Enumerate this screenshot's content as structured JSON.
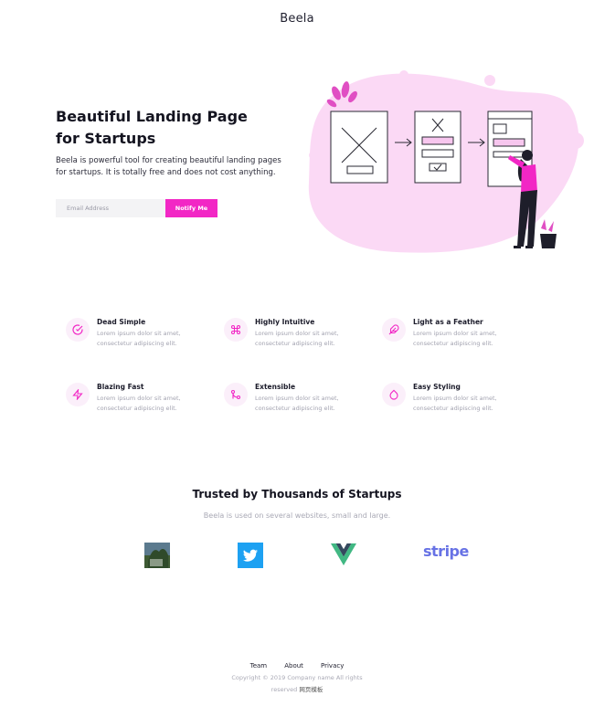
{
  "brand": "Beela",
  "hero": {
    "title": "Beautiful Landing Page for Startups",
    "subtitle": "Beela is powerful tool for creating beautiful landing pages for startups. It is totally free and does not cost anything.",
    "email_placeholder": "Email Address",
    "notify_label": "Notify Me"
  },
  "features": [
    {
      "title": "Dead Simple",
      "desc": "Lorem ipsum dolor sit amet, consectetur adipiscing elit.",
      "icon": "check-circle-icon"
    },
    {
      "title": "Highly Intuitive",
      "desc": "Lorem ipsum dolor sit amet, consectetur adipiscing elit.",
      "icon": "command-icon"
    },
    {
      "title": "Light as a Feather",
      "desc": "Lorem ipsum dolor sit amet, consectetur adipiscing elit.",
      "icon": "feather-icon"
    },
    {
      "title": "Blazing Fast",
      "desc": "Lorem ipsum dolor sit amet, consectetur adipiscing elit.",
      "icon": "zap-icon"
    },
    {
      "title": "Extensible",
      "desc": "Lorem ipsum dolor sit amet, consectetur adipiscing elit.",
      "icon": "git-merge-icon"
    },
    {
      "title": "Easy Styling",
      "desc": "Lorem ipsum dolor sit amet, consectetur adipiscing elit.",
      "icon": "droplet-icon"
    }
  ],
  "trusted": {
    "title": "Trusted by Thousands of Startups",
    "subtitle": "Beela is used on several websites, small and large.",
    "logos": [
      "photo-logo",
      "twitter-logo",
      "vue-logo",
      "stripe-logo"
    ],
    "stripe_text": "stripe"
  },
  "footer": {
    "links": [
      "Team",
      "About",
      "Privacy"
    ],
    "copyright": "Copyright © 2019 Company name All rights",
    "credit_prefix": "reserved",
    "credit_cn": "网页模板"
  },
  "colors": {
    "accent": "#f227c5",
    "blob": "#fbd9f5",
    "icon_bg": "#fbeffa"
  }
}
